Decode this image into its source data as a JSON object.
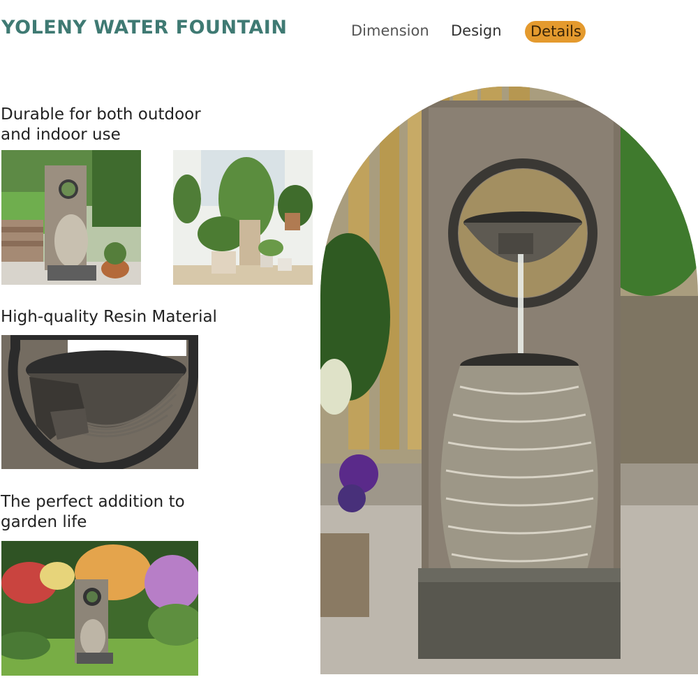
{
  "header": {
    "brand": "YOLENY WATER FOUNTAIN",
    "tabs": [
      {
        "label": "Dimension",
        "active": false
      },
      {
        "label": "Design",
        "active": false
      },
      {
        "label": "Details",
        "active": true
      }
    ],
    "active_tab_color": "#e49a2e",
    "brand_color": "#3f7a73"
  },
  "features": [
    {
      "line1": "Durable for both outdoor",
      "line2": "and indoor use"
    },
    {
      "line1": "High-quality Resin Material",
      "line2": ""
    },
    {
      "line1": "The perfect addition to",
      "line2": "garden life"
    }
  ]
}
